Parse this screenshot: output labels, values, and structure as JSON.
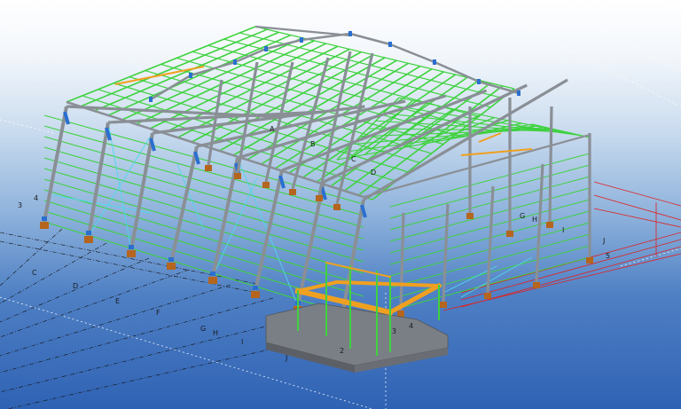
{
  "scene": {
    "grid_labels_left": [
      "3",
      "4"
    ],
    "grid_labels_front": [
      "C",
      "D",
      "E",
      "F",
      "G",
      "H",
      "I",
      "J"
    ],
    "grid_labels_right": [
      "G",
      "H",
      "I",
      "J",
      "5"
    ],
    "grid_labels_axis_front": [
      "2",
      "3",
      "4"
    ],
    "grid_labels_roof": [
      "A",
      "B",
      "C",
      "D"
    ],
    "colors": {
      "primary_beam": "#8a8f96",
      "purlin": "#3fd23f",
      "bracing": "#4fd8e8",
      "connection": "#2a6fd0",
      "footing": "#b5651d",
      "mezzanine_beam": "#f0a020",
      "slab": "#7a7f86",
      "dim_line": "#e02020",
      "grid_line": "#111111",
      "bg_top": "#ffffff",
      "bg_bottom": "#2f62b4"
    }
  }
}
